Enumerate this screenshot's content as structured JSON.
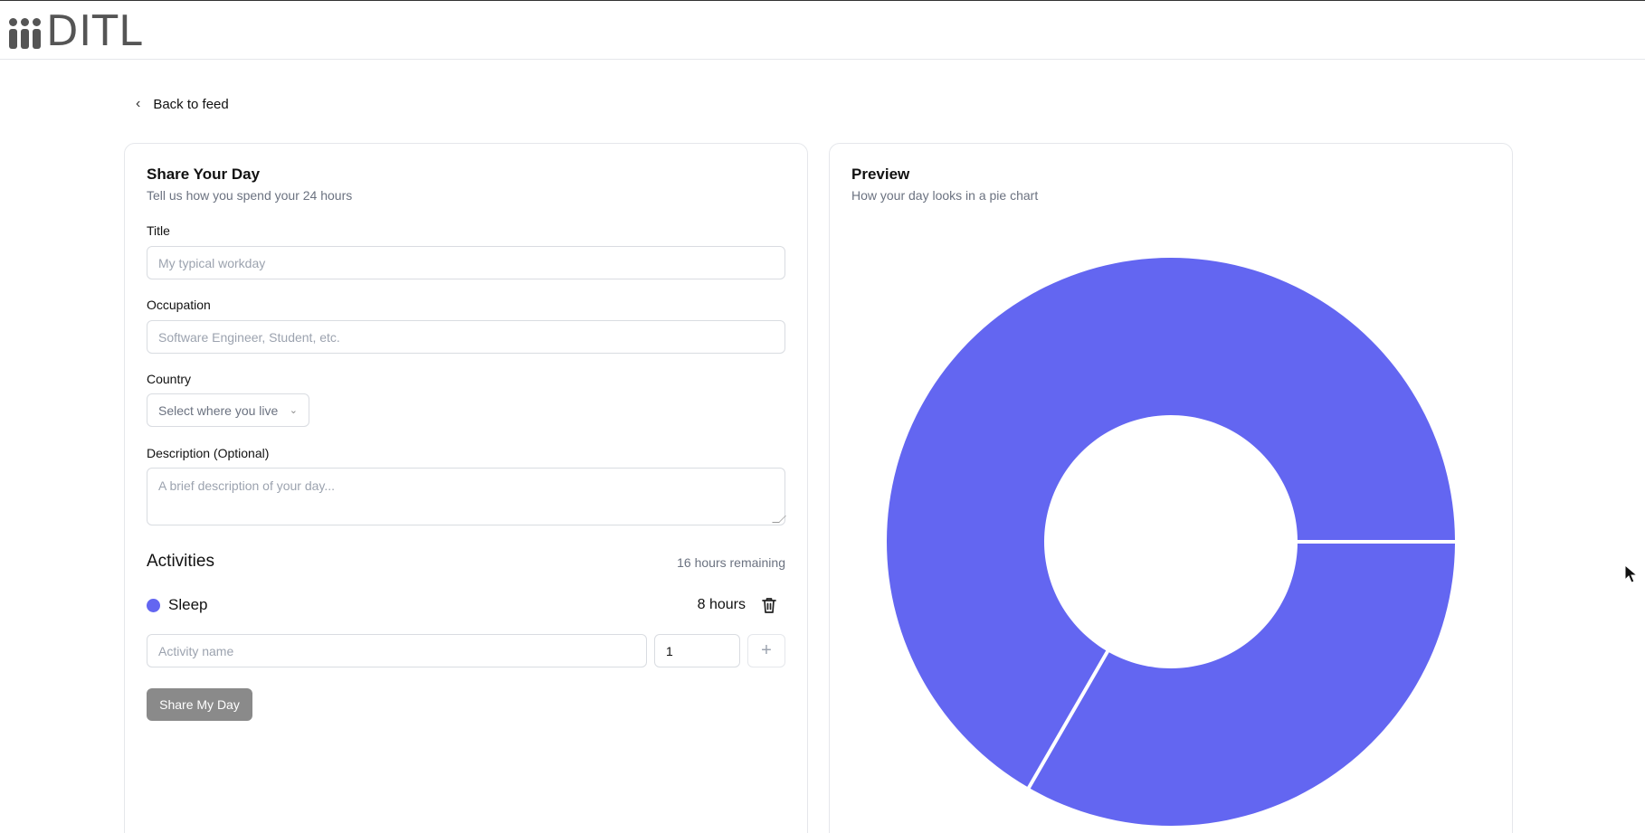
{
  "header": {
    "logo_text": "DITL"
  },
  "nav": {
    "back_label": "Back to feed",
    "back_icon": "chevron-left-icon"
  },
  "form": {
    "title": "Share Your Day",
    "subtitle": "Tell us how you spend your 24 hours",
    "fields": {
      "title_label": "Title",
      "title_placeholder": "My typical workday",
      "occupation_label": "Occupation",
      "occupation_placeholder": "Software Engineer, Student, etc.",
      "country_label": "Country",
      "country_placeholder": "Select where you live",
      "description_label": "Description (Optional)",
      "description_placeholder": "A brief description of your day..."
    },
    "activities": {
      "heading": "Activities",
      "remaining": "16 hours remaining",
      "items": [
        {
          "name": "Sleep",
          "hours_label": "8 hours",
          "color": "#6366f1"
        }
      ],
      "new_activity_placeholder": "Activity name",
      "new_hours_value": "1",
      "add_icon": "plus-icon"
    },
    "submit_label": "Share My Day"
  },
  "preview": {
    "title": "Preview",
    "subtitle": "How your day looks in a pie chart"
  },
  "chart_data": {
    "type": "pie",
    "style": "donut",
    "categories": [
      "Sleep",
      "Remaining"
    ],
    "values": [
      8,
      16
    ],
    "colors": [
      "#6366f1",
      "#6366f1"
    ]
  },
  "colors": {
    "accent": "#6366f1",
    "button_disabled": "#8a8a8a",
    "border": "#e5e7eb"
  }
}
